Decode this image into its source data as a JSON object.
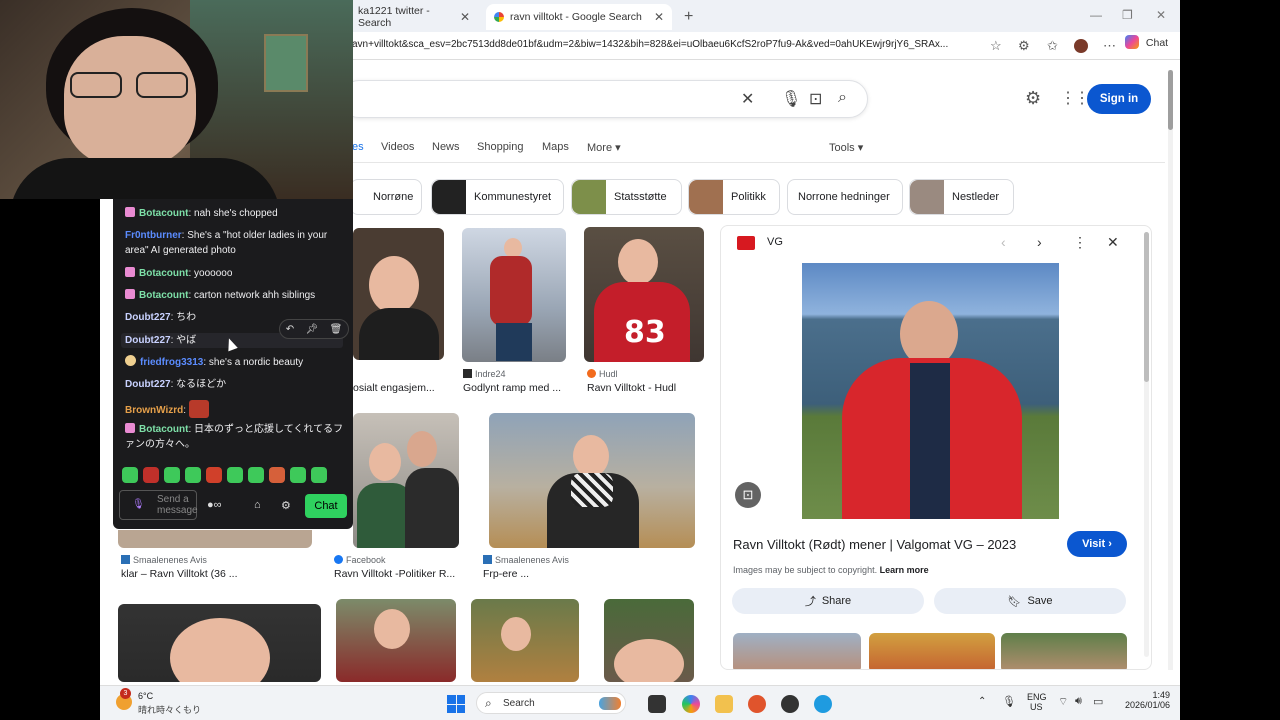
{
  "browser": {
    "tabs": [
      {
        "label": "ka1221 twitter - Search"
      },
      {
        "label": "ravn villtokt - Google Search"
      }
    ],
    "url": "avn+villtokt&sca_esv=2bc7513dd8de01bf&udm=2&biw=1432&bih=828&ei=uOlbaeu6KcfS2roP7fu9-Ak&ved=0ahUKEwjr9rjY6_SRAx...",
    "chat_label": "Chat"
  },
  "google": {
    "sign_in": "Sign in",
    "nav_tabs": [
      "es",
      "Videos",
      "News",
      "Shopping",
      "Maps",
      "More",
      "Tools"
    ],
    "chips": [
      "Norrøne",
      "Kommunestyret",
      "Statsstøtte",
      "Politikk",
      "Norrone hedninger",
      "Nestleder"
    ],
    "results": [
      {
        "source": "",
        "title": "osialt engasjem..."
      },
      {
        "source": "Indre24",
        "title": "Godlynt ramp med ..."
      },
      {
        "source": "Hudl",
        "title": "Ravn Villtokt - Hudl"
      },
      {
        "source": "Smaalenenes Avis",
        "title": "klar – Ravn Villtokt (36 ..."
      },
      {
        "source": "Facebook",
        "title": "Ravn Villtokt -Politiker R..."
      },
      {
        "source": "Smaalenenes Avis",
        "title": "Frp-ere ..."
      }
    ],
    "panel": {
      "source": "VG",
      "title": "Ravn Villtokt (Rødt) mener | Valgomat VG – 2023",
      "visit": "Visit",
      "copyright": "Images may be subject to copyright.",
      "learn_more": "Learn more",
      "share": "Share",
      "save": "Save"
    }
  },
  "twitch_chat": {
    "messages": [
      {
        "user": "Botacount",
        "text": ": nah she's chopped",
        "color": "#7ee0a8",
        "badge": true
      },
      {
        "user": "Fr0ntburner",
        "text": ": She's a \"hot older ladies in your area\" AI generated photo",
        "color": "#5b8cff",
        "badge": false
      },
      {
        "user": "Botacount",
        "text": ": yoooooo",
        "color": "#7ee0a8",
        "badge": true
      },
      {
        "user": "Botacount",
        "text": ": carton network ahh siblings",
        "color": "#7ee0a8",
        "badge": true
      },
      {
        "user": "Doubt227",
        "text": ": ちわ",
        "color": "#c9d2ff",
        "badge": false
      },
      {
        "user": "Doubt227",
        "text": ": やば",
        "color": "#c9d2ff",
        "badge": false
      },
      {
        "user": "friedfrog3313",
        "text": ": she's a nordic beauty",
        "color": "#5b8cff",
        "badge": false
      },
      {
        "user": "Doubt227",
        "text": ": なるほどか",
        "color": "#c9d2ff",
        "badge": false
      },
      {
        "user": "BrownWizrd",
        "text": ":",
        "color": "#e6a04a",
        "badge": false
      },
      {
        "user": "Botacount",
        "text": ": 日本のずっと応援してくれてるファンの方々へ。",
        "color": "#7ee0a8",
        "badge": true
      }
    ],
    "input_placeholder": "Send a message",
    "chat_button": "Chat"
  },
  "taskbar": {
    "weather_temp": "6°C",
    "weather_desc": "晴れ時々くもり",
    "weather_badge": "3",
    "search": "Search",
    "lang": "ENG",
    "region": "US",
    "time": "1:49",
    "date": "2026/01/06"
  }
}
